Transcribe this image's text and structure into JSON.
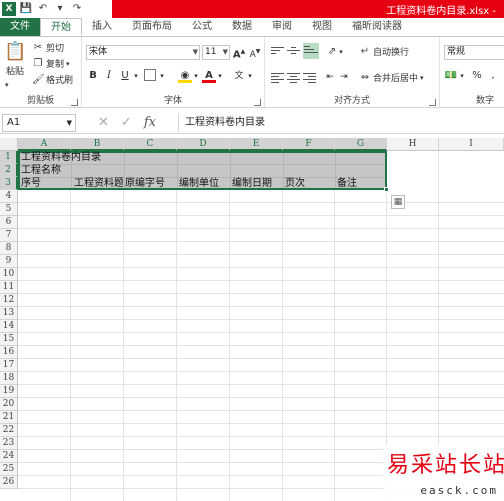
{
  "window": {
    "title": "工程资料卷内目录.xlsx -"
  },
  "qat": {
    "app_icon": "X"
  },
  "tabs": [
    {
      "label": "文件",
      "kind": "file"
    },
    {
      "label": "开始",
      "kind": "active"
    },
    {
      "label": "插入"
    },
    {
      "label": "页面布局"
    },
    {
      "label": "公式"
    },
    {
      "label": "数据"
    },
    {
      "label": "审阅"
    },
    {
      "label": "视图"
    },
    {
      "label": "福昕阅读器"
    }
  ],
  "ribbon": {
    "clipboard": {
      "paste": "粘贴",
      "cut": "剪切",
      "copy": "复制",
      "format_painter": "格式刷",
      "label": "剪贴板"
    },
    "font": {
      "name": "宋体",
      "size": "11",
      "bold": "B",
      "italic": "I",
      "underline": "U",
      "grow": "A",
      "shrink": "A",
      "label": "字体"
    },
    "alignment": {
      "wrap": "自动换行",
      "merge": "合并后居中",
      "label": "对齐方式"
    },
    "number": {
      "format": "常规",
      "percent": "%",
      "label": "数字"
    }
  },
  "formula": {
    "namebox": "A1",
    "fx": "fx",
    "content": "工程资料卷内目录"
  },
  "columns": [
    "A",
    "B",
    "C",
    "D",
    "E",
    "F",
    "G",
    "H",
    "I"
  ],
  "rows": [
    "1",
    "2",
    "3",
    "4",
    "5",
    "6",
    "7",
    "8",
    "9",
    "10",
    "11",
    "12",
    "13",
    "14",
    "15",
    "16",
    "17",
    "18",
    "19",
    "20",
    "21",
    "22",
    "23",
    "24",
    "25",
    "26"
  ],
  "cells": {
    "a1": "工程资料卷内目录",
    "a2": "工程名称",
    "a3": "序号",
    "b3": "工程资料题名",
    "c3": "原编字号",
    "d3": "编制单位",
    "e3": "编制日期",
    "f3": "页次",
    "g3": "备注"
  },
  "watermark": {
    "title": "易采站长站",
    "url": "easck.com"
  },
  "colors": {
    "excel_green": "#217346",
    "title_red": "#e60012"
  }
}
